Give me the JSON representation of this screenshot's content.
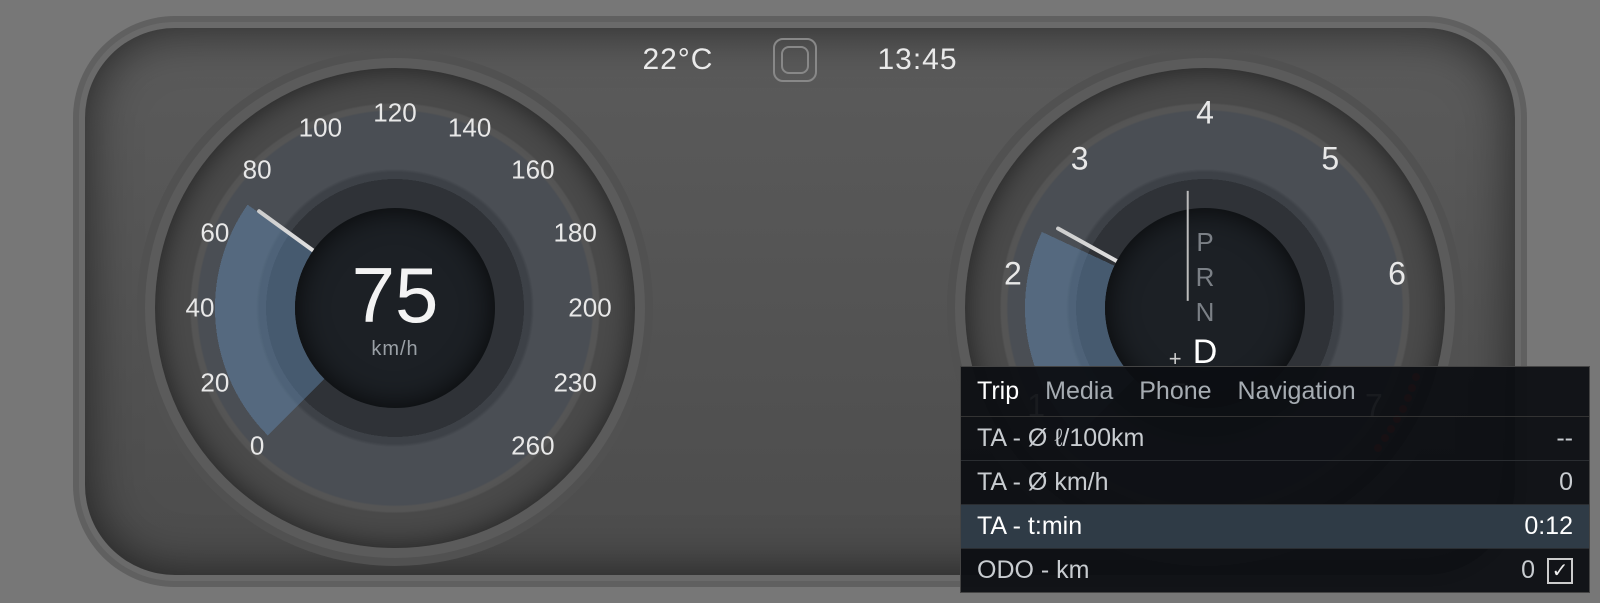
{
  "status": {
    "temp": "22°C",
    "time": "13:45"
  },
  "speedo": {
    "value": "75",
    "unit": "km/h",
    "scale": [
      "0",
      "20",
      "40",
      "60",
      "80",
      "100",
      "120",
      "140",
      "160",
      "180",
      "200",
      "230",
      "260"
    ]
  },
  "tach": {
    "scale": [
      "1",
      "2",
      "3",
      "4",
      "5",
      "6",
      "7"
    ],
    "gears": [
      "P",
      "R",
      "N",
      "D"
    ],
    "active_gear": "D"
  },
  "menu": {
    "tabs": [
      "Trip",
      "Media",
      "Phone",
      "Navigation"
    ],
    "active_tab": "Trip",
    "rows": [
      {
        "label": "TA - Ø ℓ/100km",
        "value": "--",
        "selected": false,
        "check": false
      },
      {
        "label": "TA - Ø km/h",
        "value": "0",
        "selected": false,
        "check": false
      },
      {
        "label": "TA - t:min",
        "value": "0:12",
        "selected": true,
        "check": false
      },
      {
        "label": "ODO - km",
        "value": "0",
        "selected": false,
        "check": true
      }
    ]
  }
}
